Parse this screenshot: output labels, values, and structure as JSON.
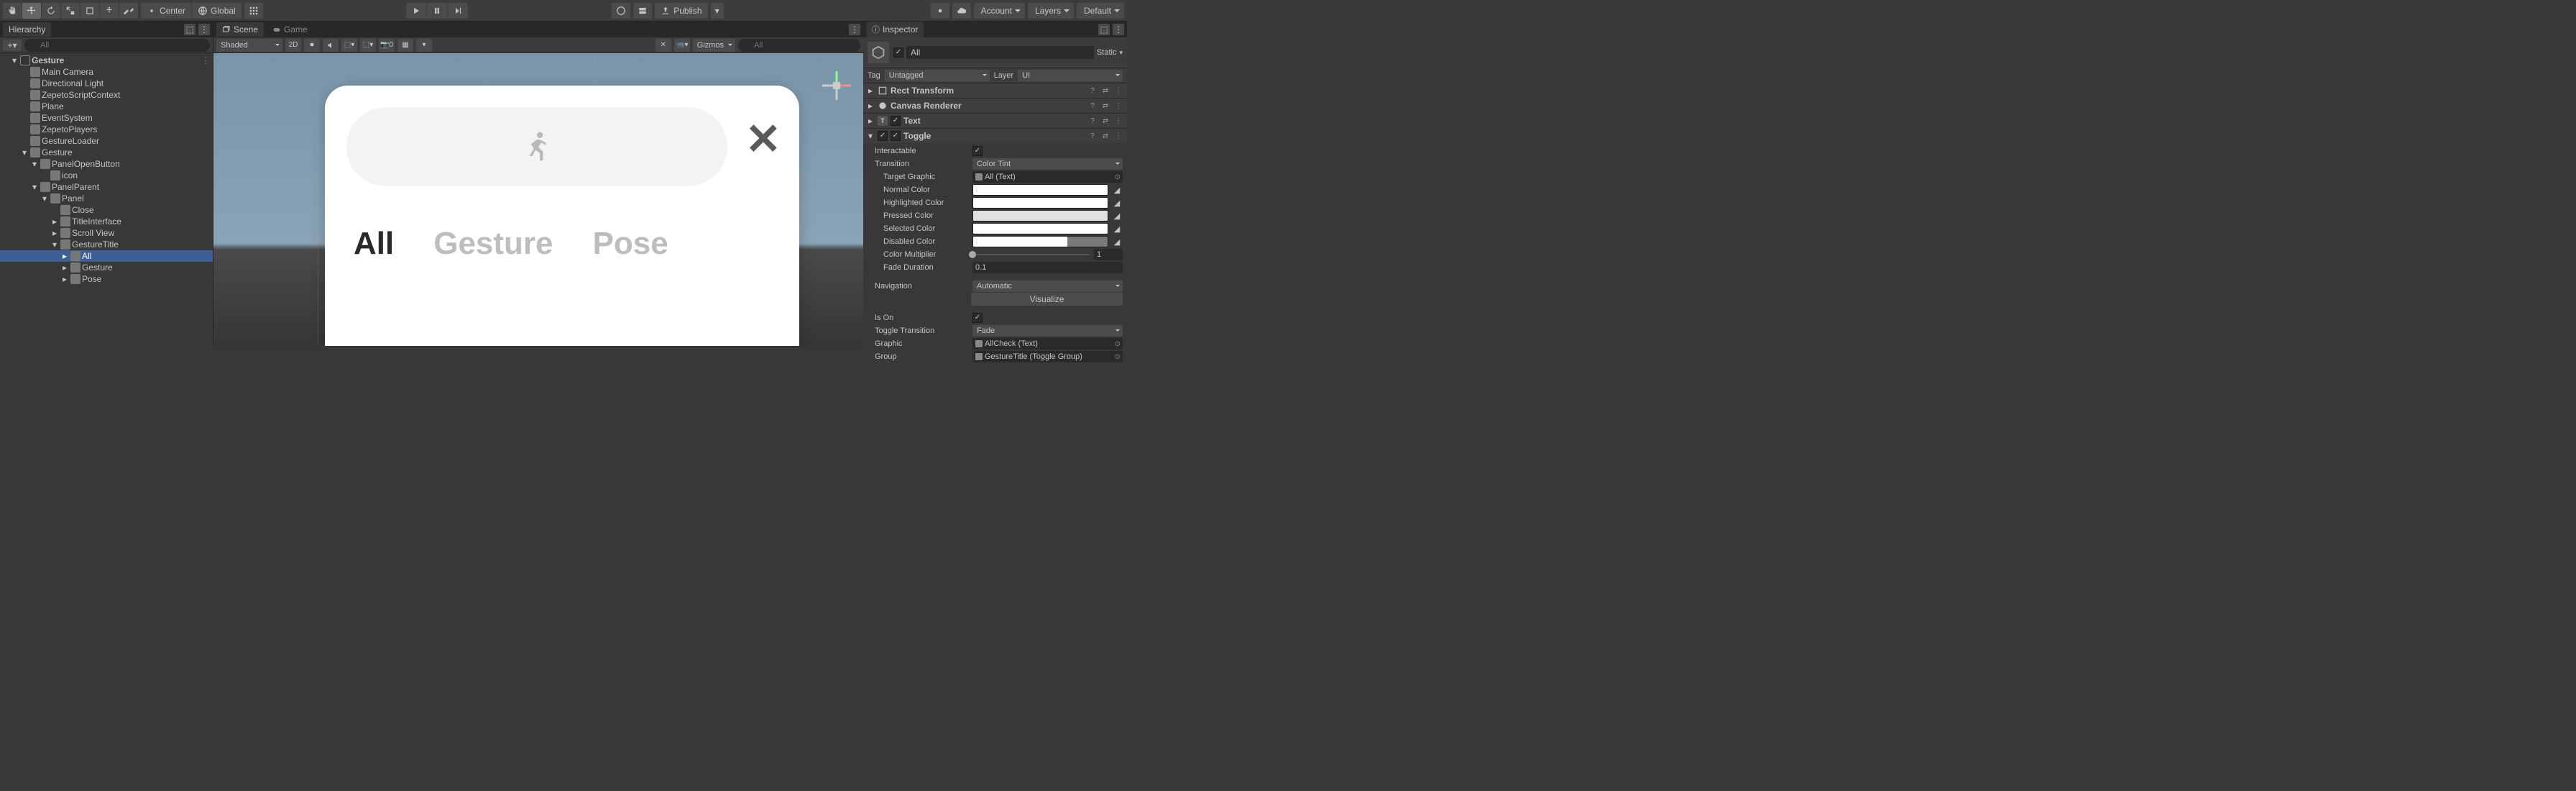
{
  "topbar": {
    "center_label": "Center",
    "global_label": "Global",
    "publish_label": "Publish",
    "account_label": "Account",
    "layers_label": "Layers",
    "layout_label": "Default"
  },
  "hierarchy": {
    "title": "Hierarchy",
    "search_placeholder": "All",
    "scene": "Gesture",
    "items": [
      {
        "label": "Main Camera",
        "depth": 1
      },
      {
        "label": "Directional Light",
        "depth": 1
      },
      {
        "label": "ZepetoScriptContext",
        "depth": 1
      },
      {
        "label": "Plane",
        "depth": 1
      },
      {
        "label": "EventSystem",
        "depth": 1
      },
      {
        "label": "ZepetoPlayers",
        "depth": 1
      },
      {
        "label": "GestureLoader",
        "depth": 1
      },
      {
        "label": "Gesture",
        "depth": 1,
        "exp": true
      },
      {
        "label": "PanelOpenButton",
        "depth": 2,
        "exp": true
      },
      {
        "label": "icon",
        "depth": 3
      },
      {
        "label": "PanelParent",
        "depth": 2,
        "exp": true
      },
      {
        "label": "Panel",
        "depth": 3,
        "exp": true
      },
      {
        "label": "Close",
        "depth": 4
      },
      {
        "label": "TitleInterface",
        "depth": 4,
        "arrow": true
      },
      {
        "label": "Scroll View",
        "depth": 4,
        "arrow": true
      },
      {
        "label": "GestureTitle",
        "depth": 4,
        "exp": true
      },
      {
        "label": "All",
        "depth": 5,
        "arrow": true,
        "sel": true
      },
      {
        "label": "Gesture",
        "depth": 5,
        "arrow": true
      },
      {
        "label": "Pose",
        "depth": 5,
        "arrow": true
      }
    ]
  },
  "scene": {
    "tab_scene": "Scene",
    "tab_game": "Game",
    "shading": "Shaded",
    "mode_2d": "2D",
    "giz_label": "Gizmos",
    "giz_zero": "0",
    "search_placeholder": "All",
    "ui": {
      "tabs": {
        "all": "All",
        "gesture": "Gesture",
        "pose": "Pose"
      },
      "close": "✕"
    }
  },
  "inspector": {
    "title": "Inspector",
    "name": "All",
    "static_label": "Static",
    "tag_label": "Tag",
    "tag_value": "Untagged",
    "layer_label": "Layer",
    "layer_value": "UI",
    "components": {
      "rect": "Rect Transform",
      "canvas": "Canvas Renderer",
      "text": "Text",
      "toggle": "Toggle"
    },
    "toggle": {
      "interactable": "Interactable",
      "transition": "Transition",
      "transition_val": "Color Tint",
      "target_graphic": "Target Graphic",
      "target_graphic_val": "All  (Text)",
      "normal": "Normal Color",
      "highlighted": "Highlighted Color",
      "pressed": "Pressed Color",
      "selected": "Selected Color",
      "disabled": "Disabled Color",
      "color_mult": "Color Multiplier",
      "color_mult_val": "1",
      "fade": "Fade Duration",
      "fade_val": "0.1",
      "navigation": "Navigation",
      "nav_val": "Automatic",
      "visualize": "Visualize",
      "ison": "Is On",
      "toggle_trans": "Toggle Transition",
      "toggle_trans_val": "Fade",
      "graphic": "Graphic",
      "graphic_val": "AllCheck (Text)",
      "group": "Group",
      "group_val": "GestureTitle (Toggle Group)"
    }
  }
}
